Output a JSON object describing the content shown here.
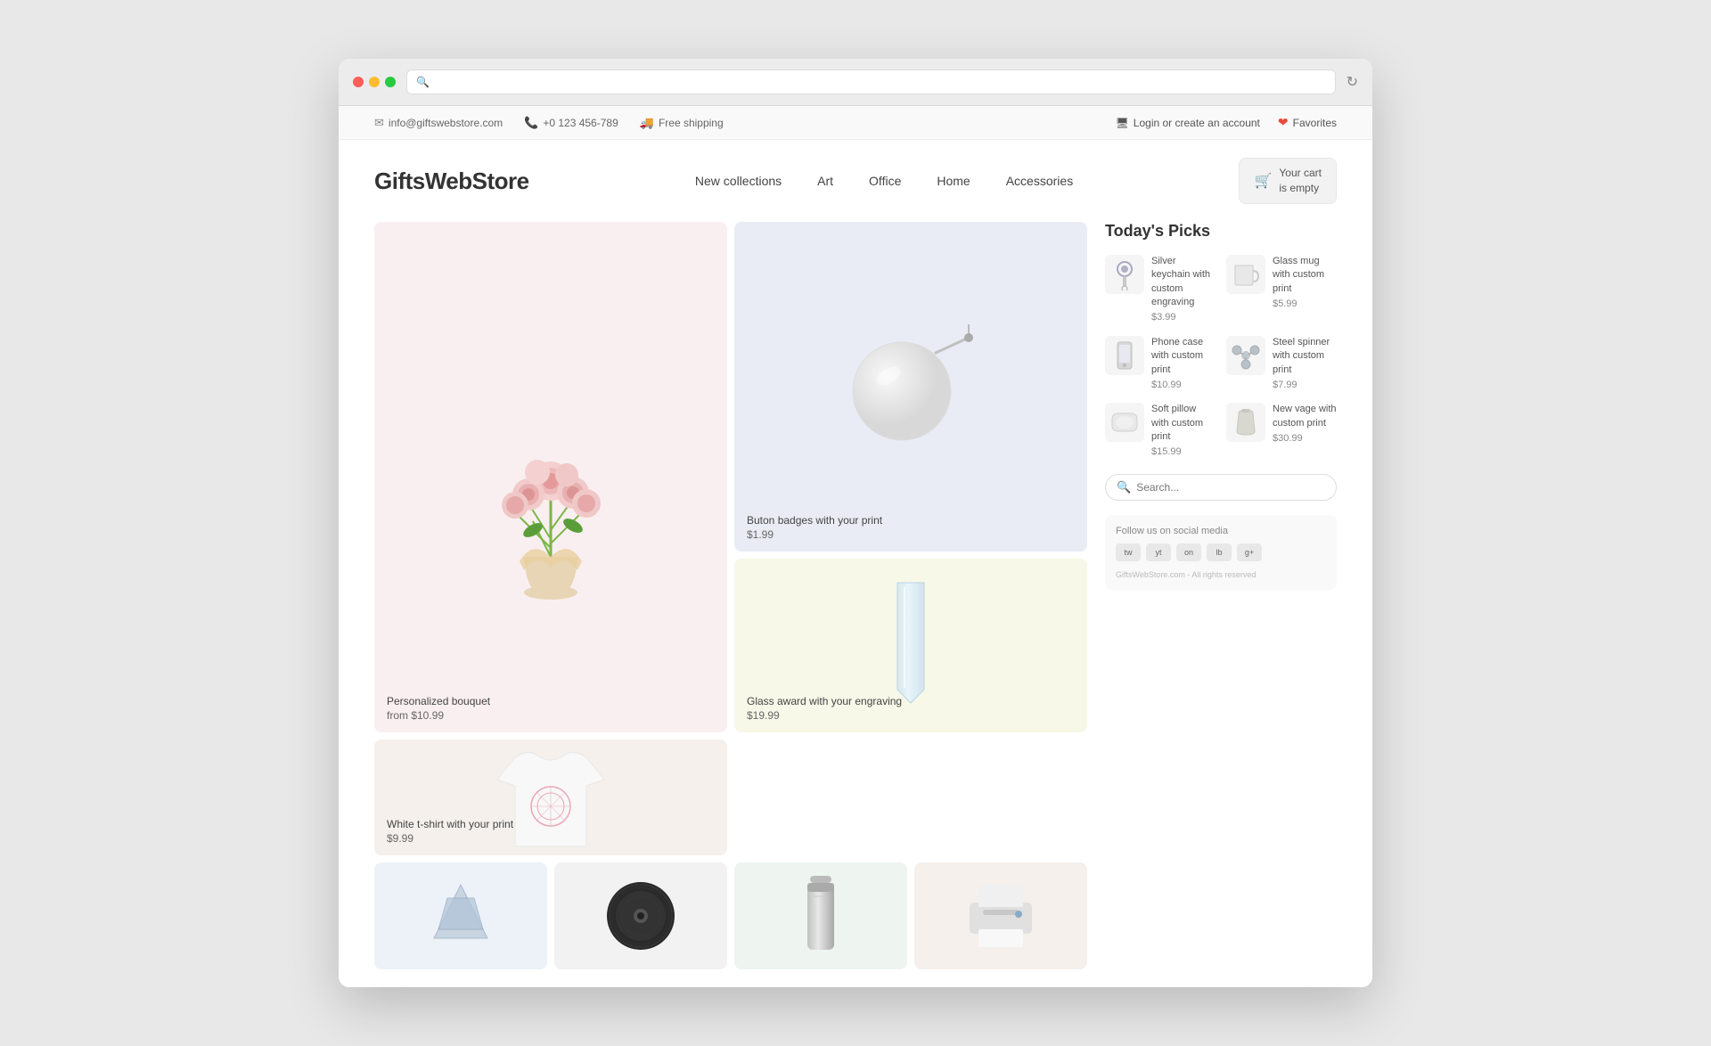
{
  "browser": {
    "dots": [
      "red",
      "yellow",
      "green"
    ]
  },
  "topbar": {
    "email": "info@giftswebstore.com",
    "phone": "+0 123 456-789",
    "shipping": "Free shipping",
    "login": "Login or create an account",
    "favorites": "Favorites"
  },
  "header": {
    "logo": "GiftsWebStore",
    "nav": [
      "New collections",
      "Art",
      "Office",
      "Home",
      "Accessories"
    ],
    "cart": "Your cart\nis empty"
  },
  "products": {
    "main": [
      {
        "id": "flowers",
        "name": "Personalized bouquet",
        "price": "from $10.99",
        "size": "large"
      },
      {
        "id": "badges",
        "name": "Buton badges with your print",
        "price": "$1.99",
        "size": "small"
      },
      {
        "id": "award",
        "name": "Glass award with your engraving",
        "price": "$19.99",
        "size": "small"
      },
      {
        "id": "tshirt",
        "name": "White t-shirt with your print",
        "price": "$9.99",
        "size": "small"
      },
      {
        "id": "geo",
        "name": "",
        "price": "",
        "size": "small-bottom"
      },
      {
        "id": "vinyl",
        "name": "",
        "price": "",
        "size": "small-bottom"
      },
      {
        "id": "thermos",
        "name": "",
        "price": "",
        "size": "small-bottom"
      },
      {
        "id": "printer",
        "name": "",
        "price": "",
        "size": "small-bottom"
      }
    ]
  },
  "sidebar": {
    "title": "Today's Picks",
    "picks": [
      {
        "name": "Silver keychain with custom engraving",
        "price": "$3.99"
      },
      {
        "name": "Glass mug with custom print",
        "price": "$5.99"
      },
      {
        "name": "Phone case with custom print",
        "price": "$10.99"
      },
      {
        "name": "Steel spinner with custom print",
        "price": "$7.99"
      },
      {
        "name": "Soft pillow with custom print",
        "price": "$15.99"
      },
      {
        "name": "New vage with custom print",
        "price": "$30.99"
      }
    ],
    "search_placeholder": "Search...",
    "social_title": "Follow us on social media",
    "social_icons": [
      "tw",
      "yt",
      "on",
      "lb",
      "g+"
    ],
    "footer": "GiftsWebStore.com - All rights reserved"
  }
}
